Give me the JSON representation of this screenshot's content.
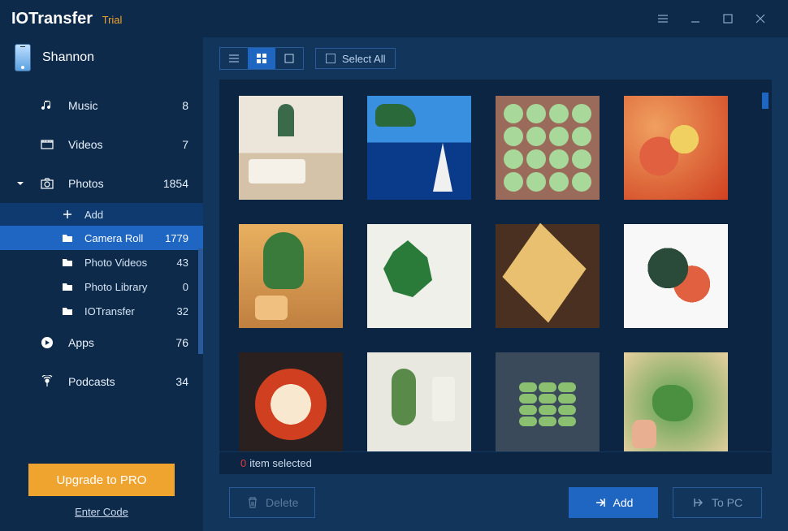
{
  "app": {
    "name": "IOTransfer",
    "edition": "Trial"
  },
  "device": {
    "name": "Shannon"
  },
  "nav": [
    {
      "icon": "music",
      "label": "Music",
      "count": "8",
      "expanded": false
    },
    {
      "icon": "video",
      "label": "Videos",
      "count": "7",
      "expanded": false
    },
    {
      "icon": "photo",
      "label": "Photos",
      "count": "1854",
      "expanded": true,
      "add_label": "Add",
      "children": [
        {
          "label": "Camera Roll",
          "count": "1779",
          "active": true
        },
        {
          "label": "Photo Videos",
          "count": "43",
          "active": false
        },
        {
          "label": "Photo Library",
          "count": "0",
          "active": false
        },
        {
          "label": "IOTransfer",
          "count": "32",
          "active": false
        }
      ]
    },
    {
      "icon": "apps",
      "label": "Apps",
      "count": "76",
      "expanded": false
    },
    {
      "icon": "podcast",
      "label": "Podcasts",
      "count": "34",
      "expanded": false
    }
  ],
  "sidebar_footer": {
    "upgrade": "Upgrade to PRO",
    "enter_code": "Enter Code"
  },
  "toolbar": {
    "select_all": "Select All"
  },
  "status": {
    "count": "0",
    "text": "item selected"
  },
  "actions": {
    "delete": "Delete",
    "add": "Add",
    "to_pc": "To PC"
  }
}
